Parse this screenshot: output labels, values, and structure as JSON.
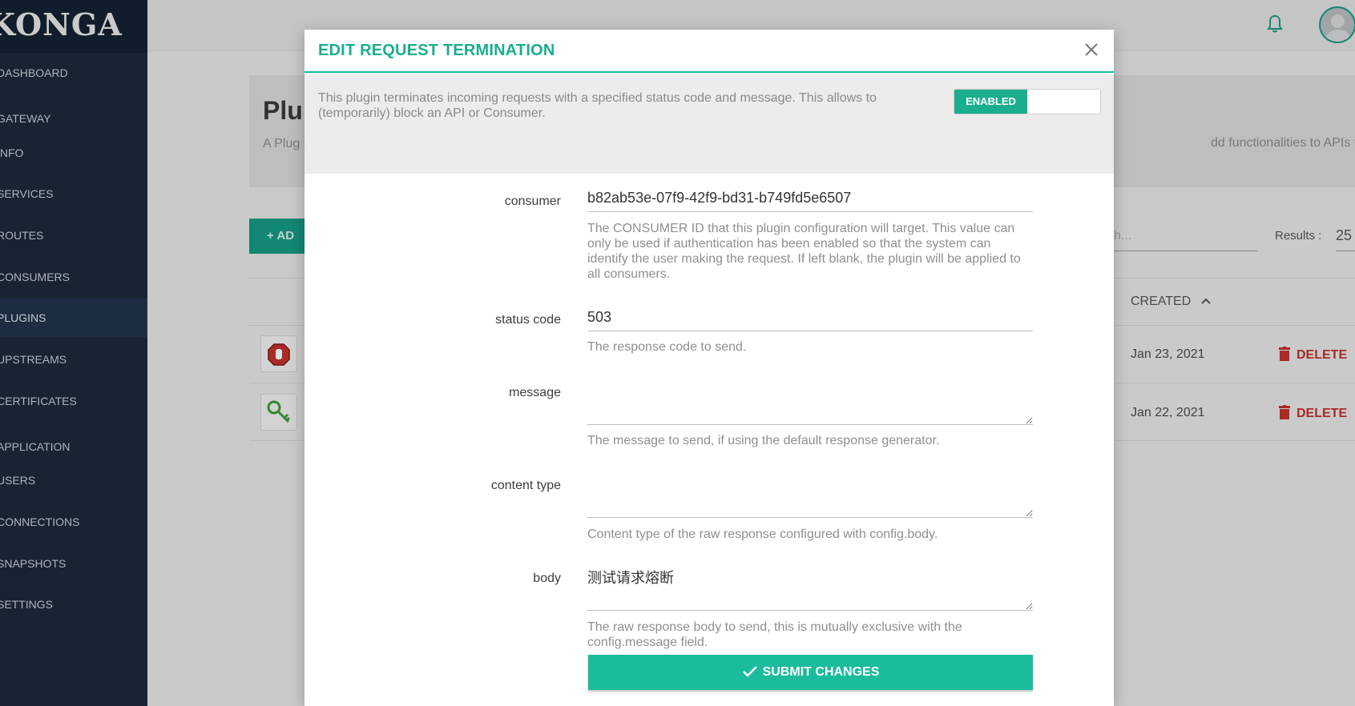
{
  "app": {
    "logo_text": "KONGA",
    "nav": [
      {
        "label": "Dashboard"
      },
      {
        "label": "Gateway"
      },
      {
        "label": "Info"
      },
      {
        "label": "Services"
      },
      {
        "label": "Routes"
      },
      {
        "label": "Consumers"
      },
      {
        "label": "Plugins"
      },
      {
        "label": "Upstreams"
      },
      {
        "label": "Certificates"
      },
      {
        "label": "Application"
      },
      {
        "label": "Users"
      },
      {
        "label": "Connections"
      },
      {
        "label": "Snapshots"
      },
      {
        "label": "Settings"
      }
    ],
    "page": {
      "title": "Plu",
      "desc_left": "A Plug behinc",
      "desc_right": "dd functionalities to APIs that run"
    },
    "add_button_label": "+ AD",
    "search_placeholder": "h...",
    "results_label": "Results :",
    "results_value": "25",
    "table": {
      "created_header": "CREATED",
      "rows": [
        {
          "icon": "stop-hand-icon",
          "created": "Jan 23, 2021",
          "delete_label": "DELETE"
        },
        {
          "icon": "key-icon",
          "created": "Jan 22, 2021",
          "delete_label": "DELETE"
        }
      ]
    },
    "accent_color": "#1abc9c",
    "danger_color": "#c0322b"
  },
  "modal": {
    "title": "EDIT REQUEST TERMINATION",
    "intro": "This plugin terminates incoming requests with a specified status code and message. This allows to (temporarily) block an API or Consumer.",
    "toggle_label": "ENABLED",
    "fields": {
      "consumer": {
        "label": "consumer",
        "value": "b82ab53e-07f9-42f9-bd31-b749fd5e6507",
        "help": "The CONSUMER ID that this plugin configuration will target. This value can only be used if authentication has been enabled so that the system can identify the user making the request. If left blank, the plugin will be applied to all consumers."
      },
      "status_code": {
        "label": "status code",
        "value": "503",
        "help": "The response code to send."
      },
      "message": {
        "label": "message",
        "value": "",
        "help": "The message to send, if using the default response generator."
      },
      "content_type": {
        "label": "content type",
        "value": "",
        "help": "Content type of the raw response configured with config.body."
      },
      "body": {
        "label": "body",
        "value": "测试请求熔断",
        "help": "The raw response body to send, this is mutually exclusive with the config.message field."
      }
    },
    "submit_label": "SUBMIT CHANGES"
  }
}
